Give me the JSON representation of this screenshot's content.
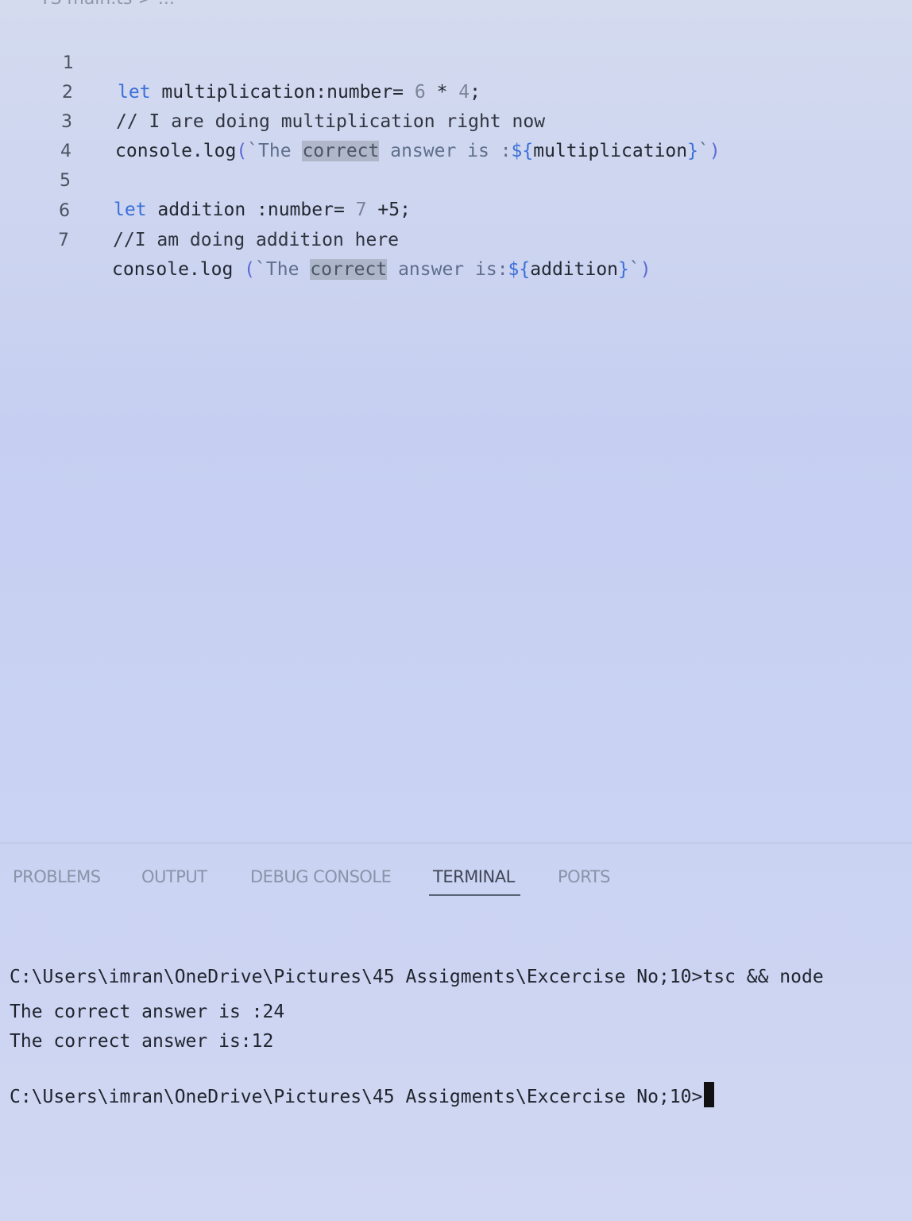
{
  "editor": {
    "breadcrumb": "TS main.ts > ...",
    "lines": [
      {
        "num": "1",
        "kw": "let",
        "text": " multiplication:number= ",
        "n1": "6",
        "op": " * ",
        "n2": "4",
        "end": ";"
      },
      {
        "num": "2",
        "comment": "// I are doing multiplication right now"
      },
      {
        "num": "3",
        "fn": "console.log",
        "open": "(",
        "s1": "`The ",
        "hl": "correct",
        "s2": " answer is :",
        "tpl_open": "${",
        "var": "multiplication",
        "tpl_close": "}",
        "s3": "`",
        "close": ")"
      },
      {
        "num": "4"
      },
      {
        "num": "5",
        "kw": "let",
        "text": " addition :number= ",
        "n1": "7",
        "op": " +",
        "n2": "5",
        "end": ";"
      },
      {
        "num": "6",
        "comment": "//I am doing addition here"
      },
      {
        "num": "7",
        "fn": "console.log ",
        "open": "(",
        "s1": "`The ",
        "hl": "correct",
        "s2": " answer is:",
        "tpl_open": "${",
        "var": "addition",
        "tpl_close": "}",
        "s3": "`",
        "close": ")"
      }
    ]
  },
  "panel": {
    "tabs": [
      "PROBLEMS",
      "OUTPUT",
      "DEBUG CONSOLE",
      "TERMINAL",
      "PORTS"
    ],
    "active_tab": "TERMINAL"
  },
  "terminal": {
    "lines": [
      "C:\\Users\\imran\\OneDrive\\Pictures\\45 Assigments\\Excercise No;10>tsc && node",
      "The correct answer is :24",
      "The correct answer is:12",
      "",
      "C:\\Users\\imran\\OneDrive\\Pictures\\45 Assigments\\Excercise No;10>"
    ]
  }
}
